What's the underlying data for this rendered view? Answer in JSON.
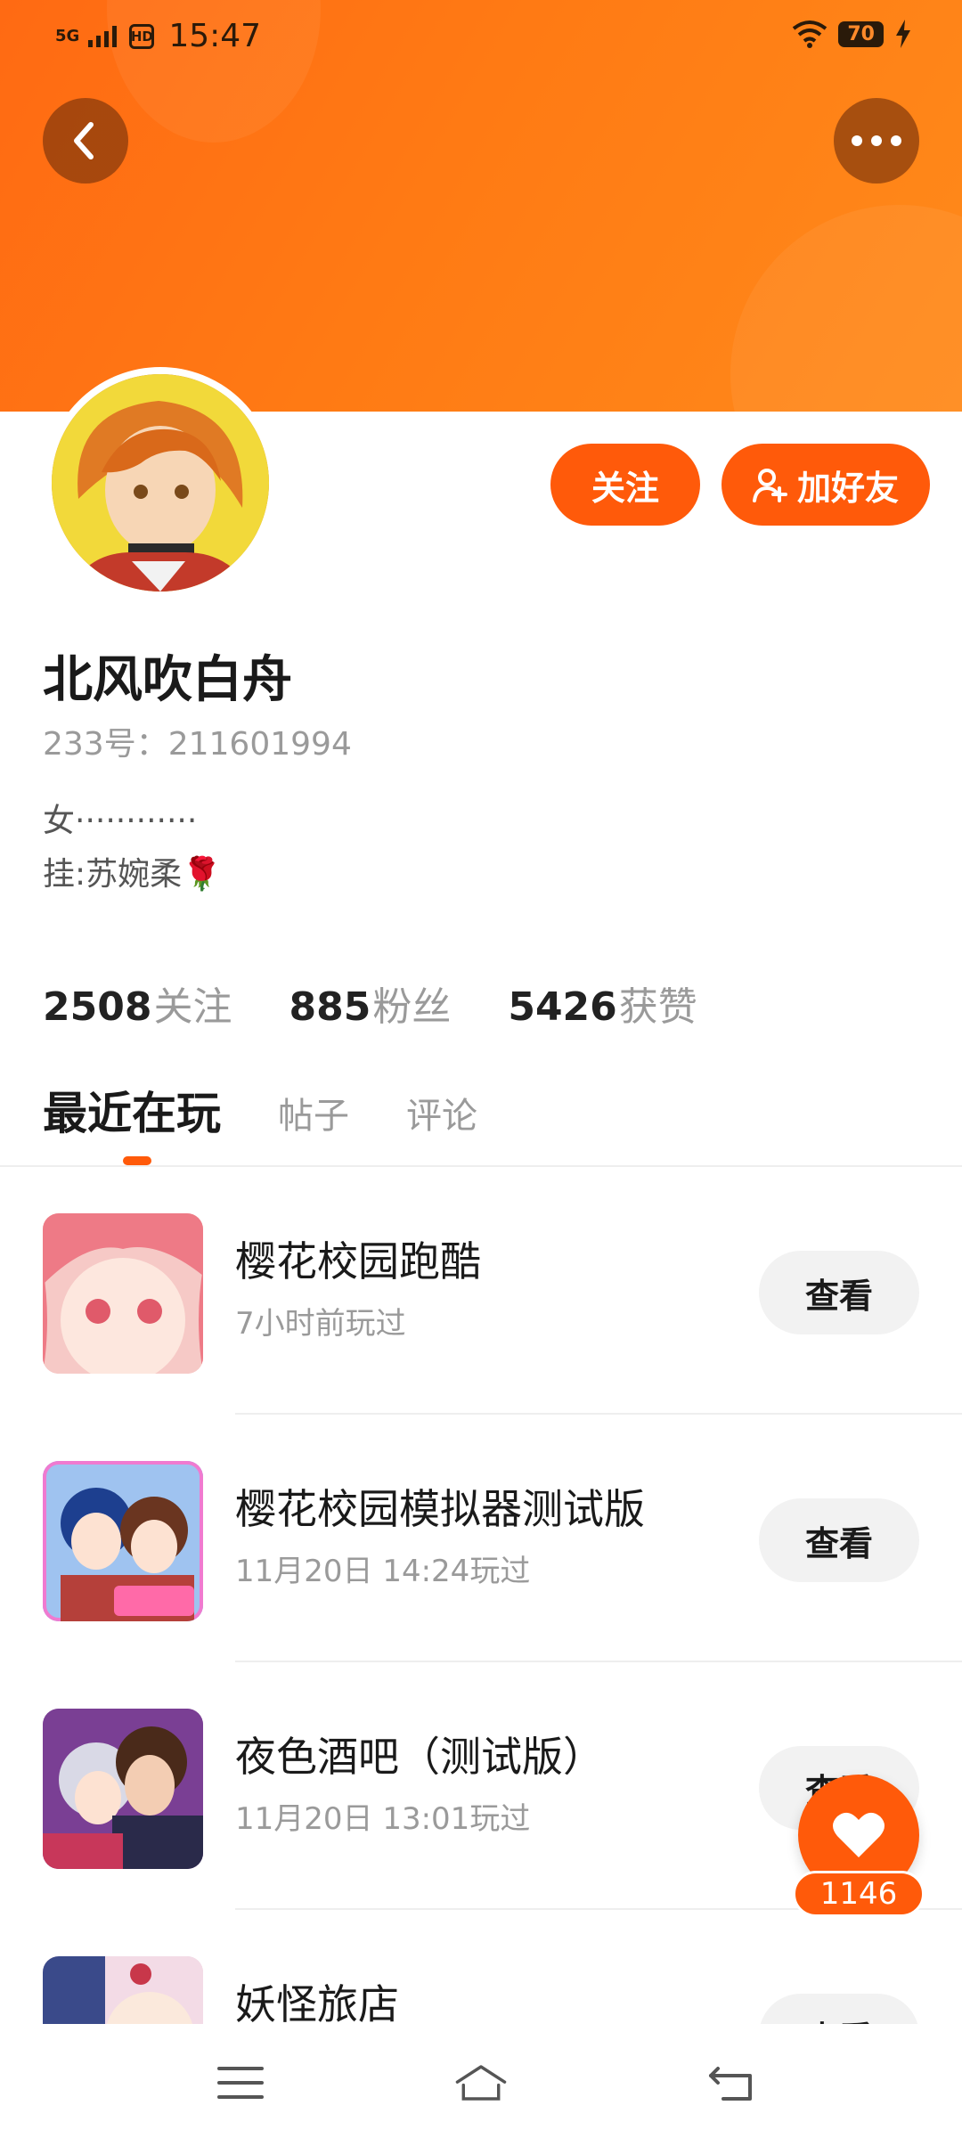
{
  "status_bar": {
    "network": "5G",
    "hd": "HD",
    "time": "15:47",
    "battery": "70"
  },
  "header": {
    "back_icon": "chevron-left-icon",
    "more_icon": "more-dots-icon"
  },
  "profile": {
    "follow_label": "关注",
    "add_friend_label": "加好友",
    "name": "北风吹白舟",
    "uid": "233号：211601994",
    "bio_line1": "女············",
    "bio_line2": "挂:苏婉柔🌹"
  },
  "stats": {
    "following_count": "2508",
    "following_label": "关注",
    "fans_count": "885",
    "fans_label": "粉丝",
    "likes_count": "5426",
    "likes_label": "获赞"
  },
  "tabs": [
    {
      "label": "最近在玩",
      "active": true
    },
    {
      "label": "帖子",
      "active": false
    },
    {
      "label": "评论",
      "active": false
    }
  ],
  "games": [
    {
      "title": "樱花校园跑酷",
      "subtitle": "7小时前玩过",
      "button": "查看",
      "icon_color": "#f3a3a8"
    },
    {
      "title": "樱花校园模拟器测试版",
      "subtitle": "11月20日 14:24玩过",
      "button": "查看",
      "icon_color": "#6d8fd6"
    },
    {
      "title": "夜色酒吧（测试版）",
      "subtitle": "11月20日 13:01玩过",
      "button": "查看",
      "icon_color": "#8a4da0"
    },
    {
      "title": "妖怪旅店",
      "subtitle": "",
      "button": "查看",
      "icon_color": "#e9c2d3"
    }
  ],
  "like_fab": {
    "count": "1146"
  },
  "accent_color": "#ff5a0a"
}
